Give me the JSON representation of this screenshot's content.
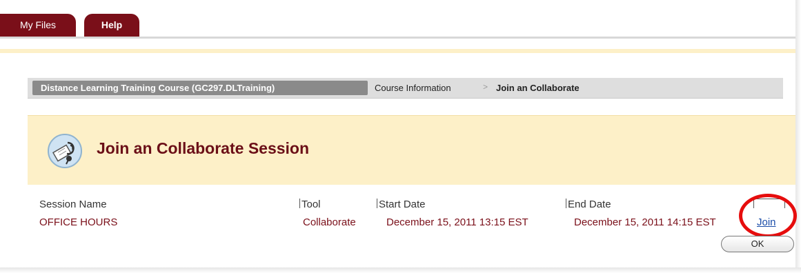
{
  "tabs": [
    {
      "label": "My Files"
    },
    {
      "label": "Help"
    }
  ],
  "breadcrumb": {
    "course": "Distance Learning Training Course (GC297.DLTraining)",
    "info": "Course Information",
    "separator": ">",
    "current": "Join an Collaborate"
  },
  "page": {
    "title": "Join an Collaborate Session",
    "icon": "collaborate-session-icon"
  },
  "table": {
    "headers": {
      "session_name": "Session Name",
      "tool": "Tool",
      "start_date": "Start Date",
      "end_date": "End Date"
    },
    "rows": [
      {
        "session_name": "OFFICE HOURS",
        "tool": "Collaborate",
        "start_date": "December 15, 2011 13:15 EST",
        "end_date": "December 15, 2011 14:15 EST",
        "action": "Join"
      }
    ]
  },
  "buttons": {
    "ok": "OK"
  },
  "colors": {
    "tab": "#7a0f19",
    "title": "#6b0f17",
    "header_bg": "#fdf0c8",
    "annotation": "#e60d0d",
    "link": "#1a4ca8"
  }
}
